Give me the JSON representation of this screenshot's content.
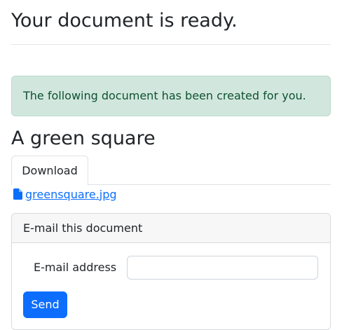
{
  "header": {
    "title": "Your document is ready."
  },
  "alert": {
    "message": "The following document has been created for you."
  },
  "document": {
    "title": "A green square",
    "tabs": [
      {
        "label": "Download",
        "active": true
      }
    ],
    "file": {
      "name": "greensquare.jpg",
      "icon": "file-icon"
    }
  },
  "email_card": {
    "header": "E-mail this document",
    "field_label": "E-mail address",
    "field_value": "",
    "field_placeholder": "",
    "send_label": "Send"
  },
  "colors": {
    "accent": "#0d6efd",
    "alert_bg": "#d1e7dd",
    "alert_text": "#0f5132"
  }
}
